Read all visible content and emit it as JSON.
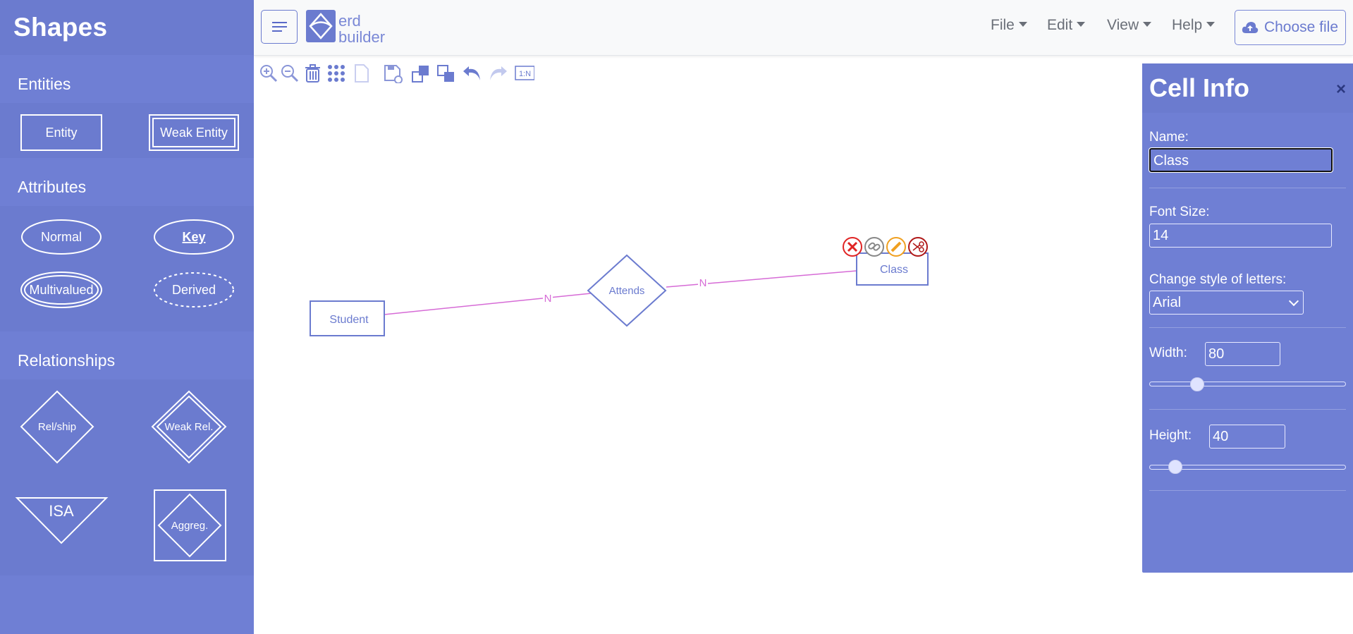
{
  "sidebar": {
    "title": "Shapes",
    "sections": {
      "entities": "Entities",
      "attributes": "Attributes",
      "relationships": "Relationships"
    },
    "shapes": {
      "entity": "Entity",
      "weak_entity": "Weak Entity",
      "normal": "Normal",
      "key": "Key",
      "multivalued": "Multivalued",
      "derived": "Derived",
      "relship": "Rel/ship",
      "weak_rel": "Weak Rel.",
      "isa": "ISA",
      "aggreg": "Aggreg."
    }
  },
  "topbar": {
    "logo_line1": "erd",
    "logo_line2": "builder",
    "menus": [
      "File",
      "Edit",
      "View",
      "Help"
    ],
    "choose_file": "Choose file"
  },
  "toolbar": {
    "cardinality_label": "1:N",
    "icons": [
      "zoom-in-icon",
      "zoom-out-icon",
      "trash-icon",
      "grid-icon",
      "page-icon",
      "save-icon",
      "bring-front-icon",
      "send-back-icon",
      "undo-icon",
      "redo-icon",
      "cardinality-icon"
    ]
  },
  "diagram": {
    "entities": [
      "Student",
      "Class"
    ],
    "relationship": "Attends",
    "cardinalities": [
      "N",
      "N"
    ],
    "selected": "Class"
  },
  "cell_info": {
    "title": "Cell Info",
    "close": "×",
    "name_label": "Name:",
    "name_value": "Class",
    "font_size_label": "Font Size:",
    "font_size_value": "14",
    "style_label": "Change style of letters:",
    "style_value": "Arial",
    "width_label": "Width:",
    "width_value": "80",
    "height_label": "Height:",
    "height_value": "40"
  },
  "colors": {
    "primary": "#6f7fd4",
    "edge": "#d66bd6",
    "delete": "#e02424",
    "edit": "#f0a020"
  }
}
